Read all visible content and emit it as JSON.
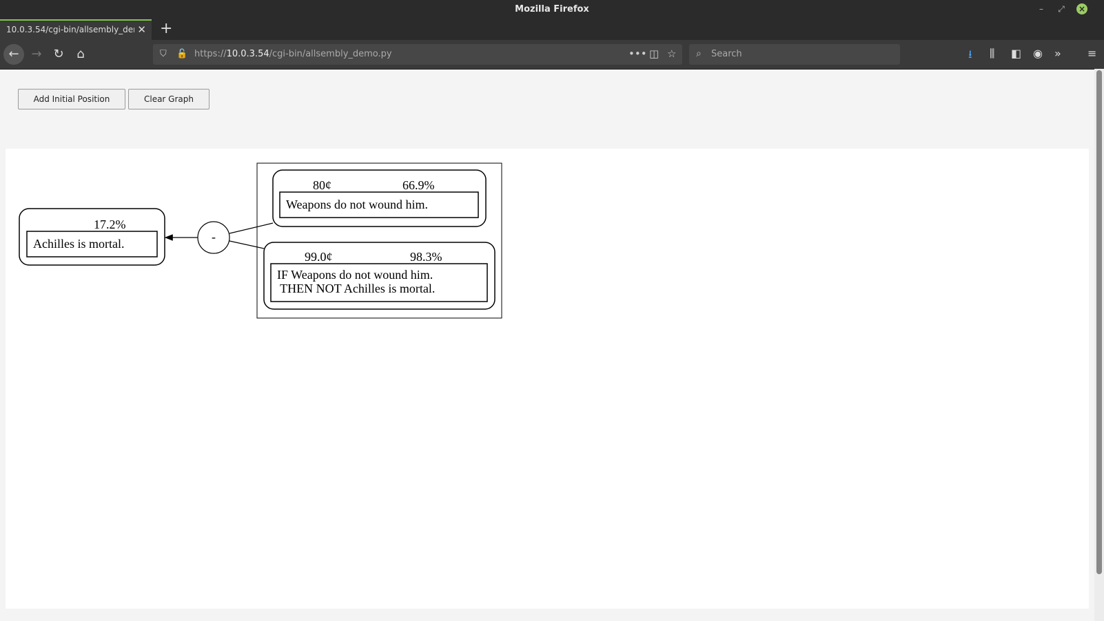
{
  "window": {
    "title": "Mozilla Firefox"
  },
  "tab": {
    "label": "10.0.3.54/cgi-bin/allsembly_demo.py"
  },
  "address": {
    "scheme": "https://",
    "host": "10.0.3.54",
    "path": "/cgi-bin/allsembly_demo.py"
  },
  "search": {
    "placeholder": "Search"
  },
  "page": {
    "buttons": {
      "add_initial_position": "Add Initial Position",
      "clear_graph": "Clear Graph"
    }
  },
  "graph": {
    "node_achilles": {
      "probability": "17.2%",
      "text": "Achilles is mortal."
    },
    "operator": {
      "symbol": "-"
    },
    "node_weapons": {
      "price": "80¢",
      "probability": "66.9%",
      "text": "Weapons do not wound him."
    },
    "node_implication": {
      "price": "99.0¢",
      "probability": "98.3%",
      "text_line1": "IF Weapons do not wound him.",
      "text_line2": " THEN NOT Achilles is mortal."
    }
  }
}
